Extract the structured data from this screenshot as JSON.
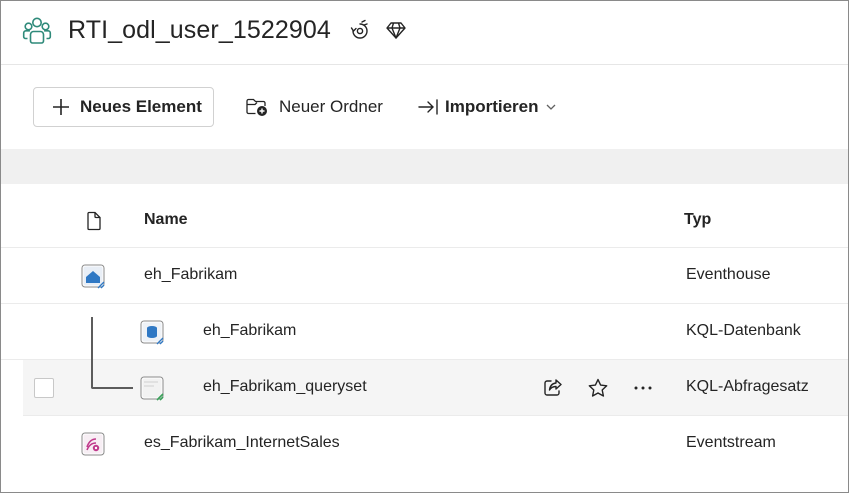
{
  "workspace": {
    "title": "RTI_odl_user_1522904",
    "icon": "workspace-people-icon",
    "header_icons": [
      "workspace-settings-icon",
      "premium-diamond-icon"
    ]
  },
  "toolbar": {
    "new_item_label": "Neues Element",
    "new_folder_label": "Neuer Ordner",
    "import_label": "Importieren"
  },
  "table": {
    "columns": {
      "name": "Name",
      "type": "Typ"
    },
    "rows": [
      {
        "name": "eh_Fabrikam",
        "type": "Eventhouse",
        "icon": "eventhouse-icon"
      },
      {
        "name": "eh_Fabrikam",
        "type": "KQL-Datenbank",
        "icon": "kql-database-icon"
      },
      {
        "name": "eh_Fabrikam_queryset",
        "type": "KQL-Abfragesatz",
        "icon": "kql-queryset-icon"
      },
      {
        "name": "es_Fabrikam_InternetSales",
        "type": "Eventstream",
        "icon": "eventstream-icon"
      }
    ]
  },
  "colors": {
    "accent_blue": "#2f78c4",
    "eventstream_pink": "#c03a8c",
    "queryset_green": "#3aa05a"
  }
}
